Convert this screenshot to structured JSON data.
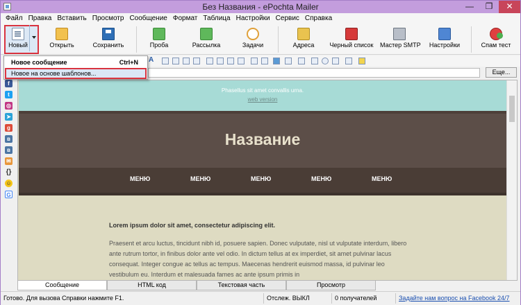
{
  "window": {
    "title": "Без Названия - ePochta Mailer",
    "controls": {
      "minimize": "—",
      "maximize": "❐",
      "close": "✕"
    }
  },
  "menu": [
    "Файл",
    "Правка",
    "Вставить",
    "Просмотр",
    "Сообщение",
    "Формат",
    "Таблица",
    "Настройки",
    "Сервис",
    "Справка"
  ],
  "toolbar": {
    "new": "Новый",
    "open": "Открыть",
    "save": "Сохранить",
    "test": "Проба",
    "send": "Рассылка",
    "tasks": "Задачи",
    "addresses": "Адреса",
    "blacklist": "Черный список",
    "smtp_wizard": "Мастер SMTP",
    "settings": "Настройки",
    "spam_test": "Спам тест"
  },
  "new_dropdown": {
    "new_message": "Новое сообщение",
    "shortcut": "Ctrl+N",
    "from_template": "Новое на основе шаблонов..."
  },
  "subject": {
    "more_button": "Еще..."
  },
  "sidebar_icons": [
    "facebook-icon",
    "twitter-icon",
    "instagram-icon",
    "telegram-icon",
    "google-plus-icon",
    "vk-icon",
    "vk-icon",
    "mail-icon",
    "curly-braces-icon",
    "emoji-icon",
    "google-icon"
  ],
  "email_preview": {
    "preheader": "Phasellus sit amet convallis urna.",
    "web_version_link": "web version",
    "heading": "Название",
    "menu_items": [
      "МЕНЮ",
      "МЕНЮ",
      "МЕНЮ",
      "МЕНЮ",
      "МЕНЮ"
    ],
    "lead": "Lorem ipsum dolor sit amet, consectetur adipiscing elit.",
    "paragraph": "Praesent et arcu luctus, tincidunt nibh id, posuere sapien. Donec vulputate, nisl ut vulputate interdum, libero ante rutrum tortor, in finibus dolor ante vel odio. In dictum tellus at ex imperdiet, sit amet pulvinar lacus consequat. Integer congue ac tellus ac tempus. Maecenas hendrerit euismod massa, id pulvinar leo vestibulum eu. Interdum et malesuada fames ac ante ipsum primis in"
  },
  "tabs": [
    {
      "label": "Сообщение",
      "active": true
    },
    {
      "label": "HTML код",
      "active": false
    },
    {
      "label": "Текстовая часть",
      "active": false
    },
    {
      "label": "Просмотр",
      "active": false
    }
  ],
  "status": {
    "ready": "Готово. Для вызова Справки нажмите F1.",
    "tracking": "Отслеж. ВЫКЛ",
    "recipients": "0 получателей",
    "facebook_link": "Задайте нам вопрос на Facebook 24/7"
  },
  "colors": {
    "title_bar": "#c39ddd",
    "highlight_outline": "#d9333f",
    "email_header_band": "#a7dbd6",
    "email_title_band": "#5c4e48",
    "email_menu_band": "#4a3d36",
    "email_body": "#dedbc2"
  }
}
